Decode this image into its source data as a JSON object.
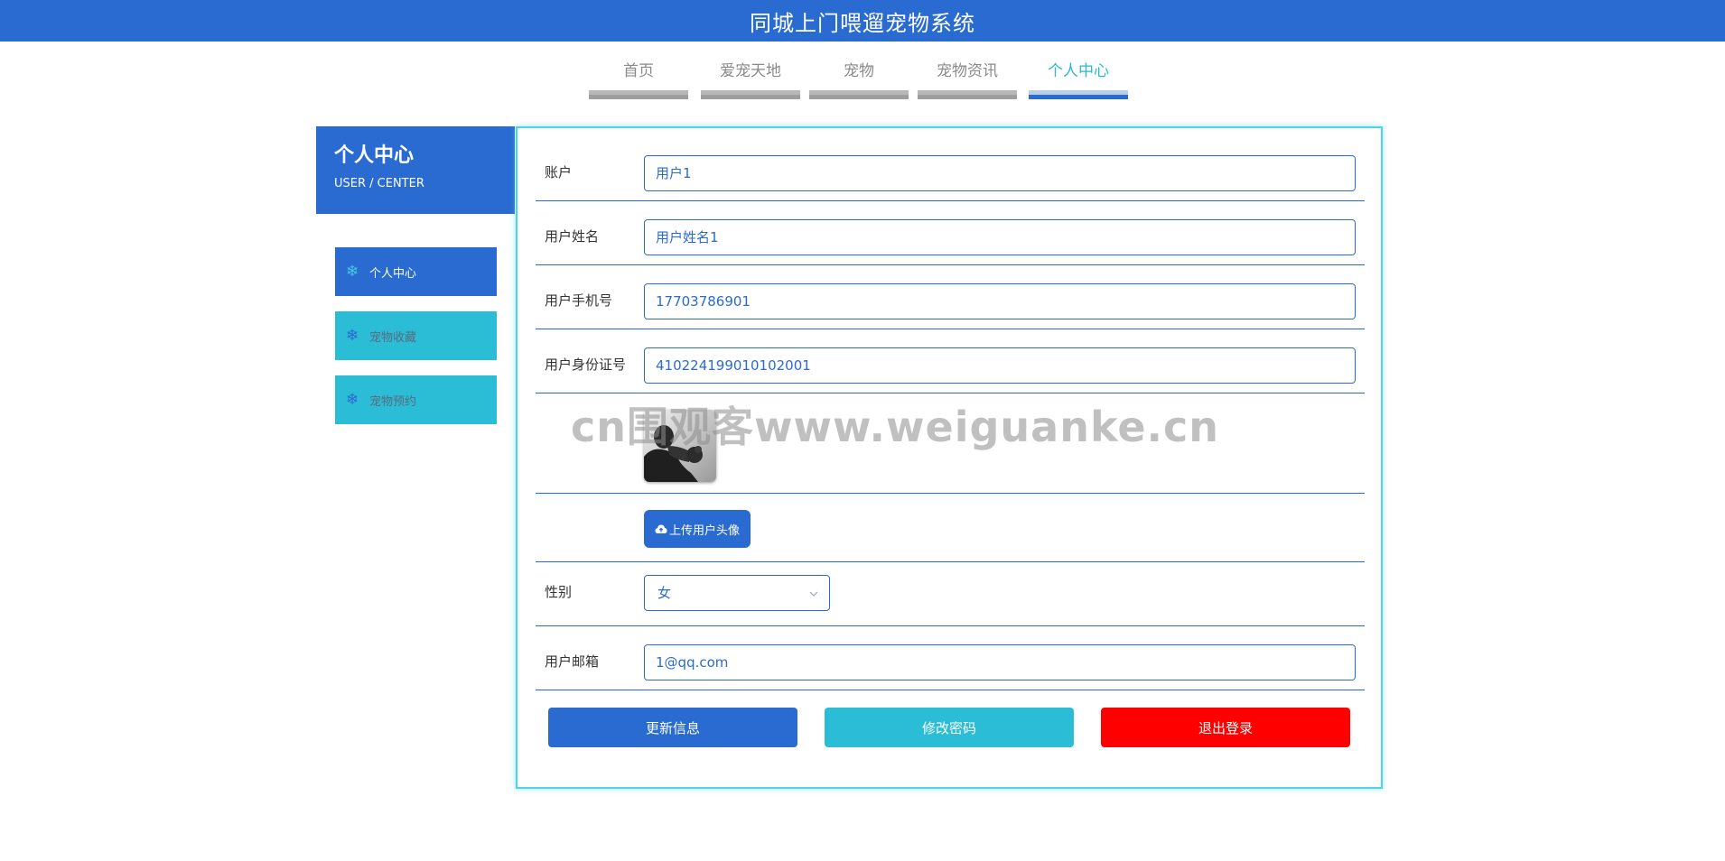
{
  "header": {
    "title": "同城上门喂遛宠物系统"
  },
  "nav": {
    "items": [
      {
        "label": "首页"
      },
      {
        "label": "爱宠天地"
      },
      {
        "label": "宠物"
      },
      {
        "label": "宠物资讯"
      },
      {
        "label": "个人中心"
      }
    ],
    "active_index": 4
  },
  "sidebar": {
    "title": "个人中心",
    "subtitle": "USER / CENTER",
    "items": [
      {
        "label": "个人中心"
      },
      {
        "label": "宠物收藏"
      },
      {
        "label": "宠物预约"
      }
    ]
  },
  "form": {
    "fields": [
      {
        "label": "账户",
        "value": "用户1"
      },
      {
        "label": "用户姓名",
        "value": "用户姓名1"
      },
      {
        "label": "用户手机号",
        "value": "17703786901"
      },
      {
        "label": "用户身份证号",
        "value": "410224199010102001"
      }
    ],
    "upload_label": "上传用户头像",
    "gender": {
      "label": "性别",
      "value": "女"
    },
    "email": {
      "label": "用户邮箱",
      "value": "1@qq.com"
    }
  },
  "buttons": {
    "update": "更新信息",
    "change_password": "修改密码",
    "logout": "退出登录"
  },
  "watermark": "cn围观客www.weiguanke.cn",
  "colors": {
    "primary": "#2a6bd1",
    "accent": "#2bbcd6",
    "danger": "#ff0000"
  },
  "icons": {
    "sidebar_item": "snowflake-icon",
    "upload": "cloud-upload-icon",
    "select": "chevron-down-icon"
  }
}
